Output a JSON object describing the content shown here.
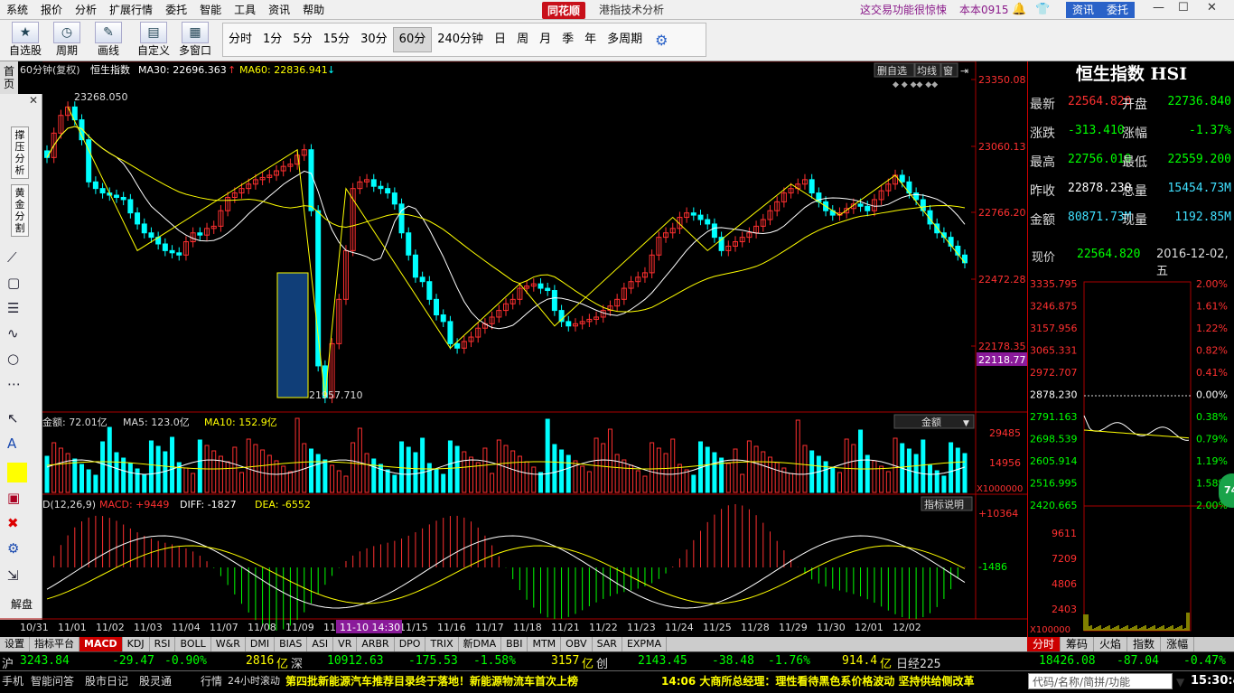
{
  "menu": {
    "items": [
      "系统",
      "报价",
      "分析",
      "扩展行情",
      "委托",
      "智能",
      "工具",
      "资讯",
      "帮助"
    ],
    "brand": "同花顺",
    "title": "港指技术分析",
    "promo": "这交易功能很惊悚",
    "user": "本本0915",
    "btn_news": "资讯",
    "btn_trade": "委托"
  },
  "toolbar": {
    "buttons": [
      {
        "label": "自选股",
        "icon": "star-icon"
      },
      {
        "label": "周期",
        "icon": "clock-icon"
      },
      {
        "label": "画线",
        "icon": "pencil-icon"
      },
      {
        "label": "自定义",
        "icon": "custom-icon"
      },
      {
        "label": "多窗口",
        "icon": "multiwindow-icon"
      }
    ],
    "periods": [
      "分时",
      "1分",
      "5分",
      "15分",
      "30分",
      "60分",
      "240分钟",
      "日",
      "周",
      "月",
      "季",
      "年",
      "多周期"
    ],
    "active_period": "60分"
  },
  "main_chart": {
    "period_label": "60分钟(复权)",
    "index_name": "恒生指数",
    "ma30_label": "MA30: 22696.363",
    "ma60_label": "MA60: 22836.941",
    "tools": [
      "删自选",
      "均线",
      "窗"
    ],
    "y_ticks": [
      "23350.08",
      "23060.13",
      "22766.20",
      "22472.28",
      "22178.35"
    ],
    "current_price_tag": "22118.77",
    "high_mark": "23268.050",
    "low_mark": "21957.710",
    "ylim": [
      21900,
      23400
    ]
  },
  "volume_chart": {
    "amount_label": "金额: 72.01亿",
    "ma5_label": "MA5: 123.0亿",
    "ma10_label": "MA10: 152.9亿",
    "selector": "金额",
    "y_ticks": [
      "29485",
      "14956"
    ],
    "unit": "X1000000"
  },
  "macd_chart": {
    "name_label": "D(12,26,9)",
    "macd_label": "MACD: +9449",
    "diff_label": "DIFF: -1827",
    "dea_label": "DEA: -6552",
    "help_btn": "指标说明",
    "y_ticks": [
      "+10364",
      "-1486"
    ]
  },
  "x_axis": {
    "dates": [
      "10/31",
      "11/01",
      "11/02",
      "11/03",
      "11/04",
      "11/07",
      "11/08",
      "11/09",
      "11/10",
      "11/14",
      "11/15",
      "11/16",
      "11/17",
      "11/18",
      "11/21",
      "11/22",
      "11/23",
      "11/24",
      "11/25",
      "11/28",
      "11/29",
      "11/30",
      "12/01",
      "12/02"
    ],
    "cursor_label": "11-10 14:30"
  },
  "left_tools": {
    "vertical_btn1": "撑压分析",
    "vertical_btn2": "黄金分割",
    "bottom_label": "解盘",
    "tab_label": "首页"
  },
  "quote": {
    "title": "恒生指数 HSI",
    "rows": [
      {
        "l1": "最新",
        "v1": "22564.820",
        "c1": "#ff3030",
        "l2": "开盘",
        "v2": "22736.840",
        "c2": "#00ff00"
      },
      {
        "l1": "涨跌",
        "v1": "-313.410",
        "c1": "#00ff00",
        "l2": "涨幅",
        "v2": "-1.37%",
        "c2": "#00ff00"
      },
      {
        "l1": "最高",
        "v1": "22756.010",
        "c1": "#00ff00",
        "l2": "最低",
        "v2": "22559.200",
        "c2": "#00ff00"
      },
      {
        "l1": "昨收",
        "v1": "22878.230",
        "c1": "#ffffff",
        "l2": "总量",
        "v2": "15454.73M",
        "c2": "#40e0ff"
      },
      {
        "l1": "金额",
        "v1": "80871.73M",
        "c1": "#40e0ff",
        "l2": "现量",
        "v2": "1192.85M",
        "c2": "#40e0ff"
      }
    ],
    "xianjia_label": "现价",
    "xianjia_value": "22564.820",
    "date": "2016-12-02,五"
  },
  "intraday": {
    "left_ticks": [
      "3335.795",
      "3246.875",
      "3157.956",
      "3065.331",
      "2972.707",
      "2878.230",
      "2791.163",
      "2698.539",
      "2605.914",
      "2516.995",
      "2420.665"
    ],
    "right_ticks": [
      "2.00%",
      "1.61%",
      "1.22%",
      "0.82%",
      "0.41%",
      "0.00%",
      "0.38%",
      "0.79%",
      "1.19%",
      "1.58%",
      "2.00%"
    ],
    "vol_ticks": [
      "9611",
      "7209",
      "4806",
      "2403"
    ],
    "vol_unit": "X100000",
    "badge": "74"
  },
  "bottom_tabs": [
    "设置",
    "指标平台",
    "MACD",
    "KDJ",
    "RSI",
    "BOLL",
    "W&R",
    "DMI",
    "BIAS",
    "ASI",
    "VR",
    "ARBR",
    "DPO",
    "TRIX",
    "新DMA",
    "BBI",
    "MTM",
    "OBV",
    "SAR",
    "EXPMA"
  ],
  "bottom_active": "MACD",
  "right_tabs": [
    "分时",
    "筹码",
    "火焰",
    "指数",
    "涨幅"
  ],
  "right_active": "分时",
  "ticker": {
    "sh_label": "沪",
    "sh_val": "3243.84",
    "sh_chg": "-29.47",
    "sh_pct": "-0.90%",
    "sh_amt": "2816",
    "sh_amt_unit": "亿",
    "sz_label": "深",
    "sz_val": "10912.63",
    "sz_chg": "-175.53",
    "sz_pct": "-1.58%",
    "sz_amt": "3157",
    "sz_amt_unit": "亿",
    "cy_label": "创",
    "cy_val": "2143.45",
    "cy_chg": "-38.48",
    "cy_pct": "-1.76%",
    "cy_amt": "914.4",
    "cy_amt_unit": "亿",
    "rj_label": "日经225",
    "rj_val": "18426.08",
    "rj_chg": "-87.04",
    "rj_pct": "-0.47%"
  },
  "status": {
    "items": [
      "手机",
      "智能问答",
      "股市日记",
      "股灵通",
      "行情",
      "24小时滚动"
    ],
    "news1": "第四批新能源汽车推荐目录终于落地！新能源物流车首次上榜",
    "news2": "14:06 大商所总经理：理性看待黑色系价格波动 坚持供给侧改革",
    "search_placeholder": "代码/名称/简拼/功能",
    "clock": "15:30:46"
  },
  "colors": {
    "up": "#ff3030",
    "down": "#00ffff",
    "ma1": "#ffffff",
    "ma2": "#ffff00",
    "grid": "#7a0000"
  }
}
